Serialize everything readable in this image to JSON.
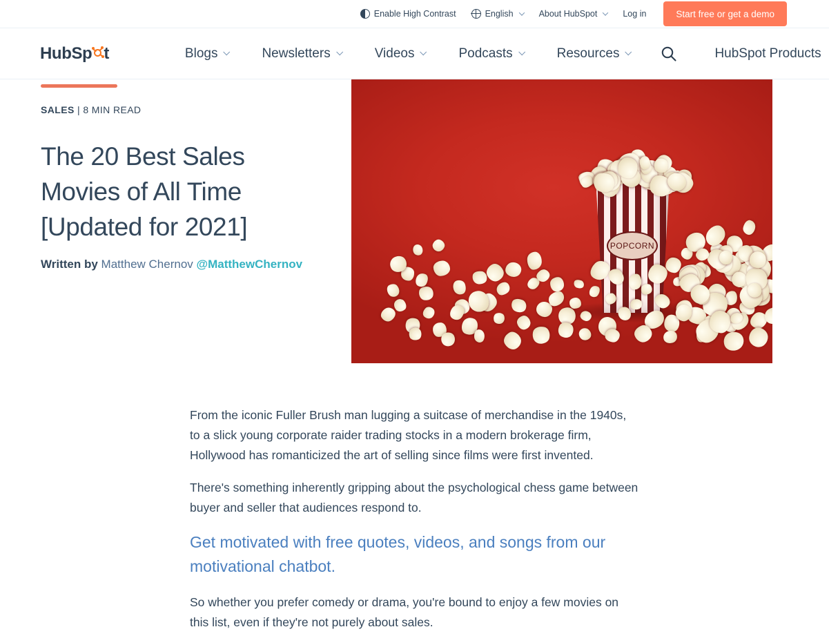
{
  "utility_bar": {
    "contrast_label": "Enable High Contrast",
    "language_label": "English",
    "about_label": "About HubSpot",
    "login_label": "Log in",
    "cta_label": "Start free or get a demo",
    "cta_color": "#ff7a59"
  },
  "main_nav": {
    "logo_text_start": "HubSp",
    "logo_text_end": "t",
    "items": [
      {
        "label": "Blogs",
        "has_caret": true
      },
      {
        "label": "Newsletters",
        "has_caret": true
      },
      {
        "label": "Videos",
        "has_caret": true
      },
      {
        "label": "Podcasts",
        "has_caret": true
      },
      {
        "label": "Resources",
        "has_caret": true
      }
    ],
    "search_icon": "search-icon",
    "products_label": "HubSpot Products"
  },
  "article": {
    "accent_color": "#ec765a",
    "topic": "SALES",
    "separator": " | ",
    "read_time": "8 MIN READ",
    "headline": "The 20 Best Sales Movies of All Time [Updated for 2021]",
    "byline_prefix": "Written by",
    "author_name": "Matthew Chernov",
    "author_handle": "@MatthewChernov",
    "hero_image_alt": "popcorn-bucket-on-red-background",
    "hero_popcorn_label": "POPCORN",
    "paragraphs": [
      "From the iconic Fuller Brush man lugging a suitcase of merchandise in the 1940s, to a slick young corporate raider trading stocks in a modern brokerage firm, Hollywood has romanticized the art of selling since films were first invented.",
      "There's something inherently gripping about the psychological chess game between buyer and seller that audiences respond to."
    ],
    "inline_cta": "Get motivated with free quotes, videos, and songs from our motivational chatbot.",
    "trailing_paragraph": "So whether you prefer comedy or drama, you're bound to enjoy a few movies on this list, even if they're not purely about sales."
  }
}
